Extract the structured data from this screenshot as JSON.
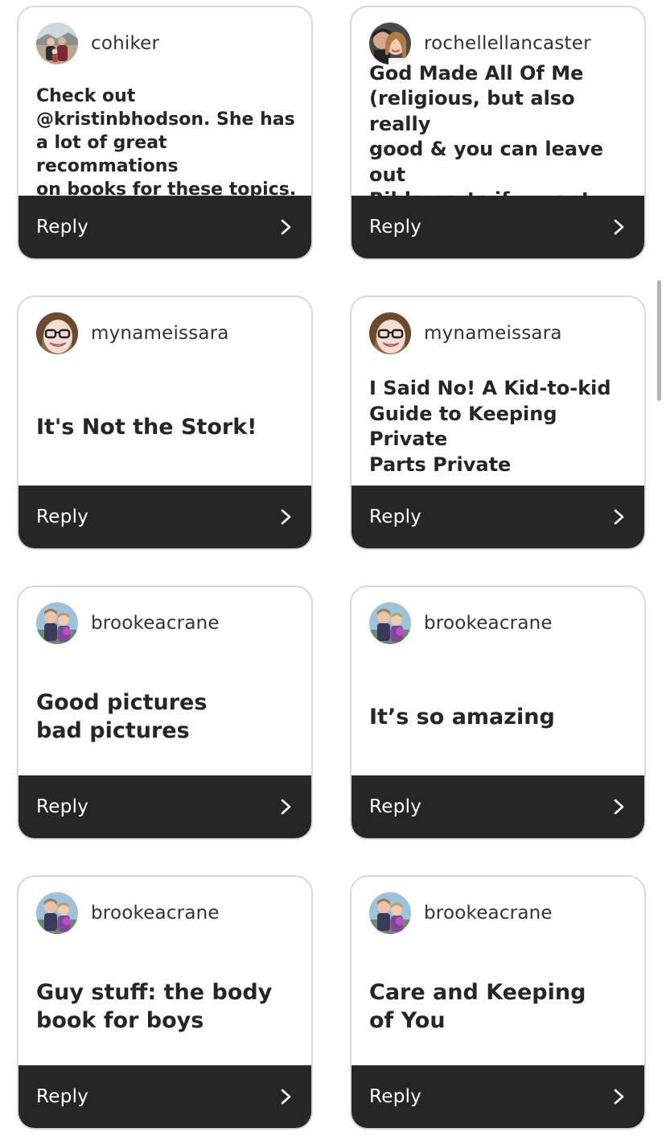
{
  "cards": [
    {
      "username": "cohiker",
      "text": "Check out\n@kristinbhodson. She has\na lot of great recommations\non books for these topics.",
      "reply_label": "Reply",
      "avatar": "family-photo-avatar"
    },
    {
      "username": "rochellellancaster",
      "text": "God Made All Of Me\n(religious, but also really\ngood & you can leave out\nBible parts if u want",
      "reply_label": "Reply",
      "avatar": "couple-selfie-avatar"
    },
    {
      "username": "mynameissara",
      "text": "It's Not the Stork!",
      "reply_label": "Reply",
      "avatar": "woman-glasses-avatar"
    },
    {
      "username": "mynameissara",
      "text": "I Said No! A Kid-to-kid\nGuide to Keeping Private\nParts Private",
      "reply_label": "Reply",
      "avatar": "woman-glasses-avatar"
    },
    {
      "username": "brookeacrane",
      "text": "Good pictures\nbad pictures",
      "reply_label": "Reply",
      "avatar": "children-avatar"
    },
    {
      "username": "brookeacrane",
      "text": "It’s so amazing",
      "reply_label": "Reply",
      "avatar": "children-avatar"
    },
    {
      "username": "brookeacrane",
      "text": "Guy stuff: the body\nbook for boys",
      "reply_label": "Reply",
      "avatar": "children-avatar"
    },
    {
      "username": "brookeacrane",
      "text": "Care and Keeping\nof You",
      "reply_label": "Reply",
      "avatar": "children-avatar"
    }
  ],
  "colors": {
    "reply_bar": "#262626",
    "card_border": "#d9d9d9",
    "text": "#262626"
  }
}
